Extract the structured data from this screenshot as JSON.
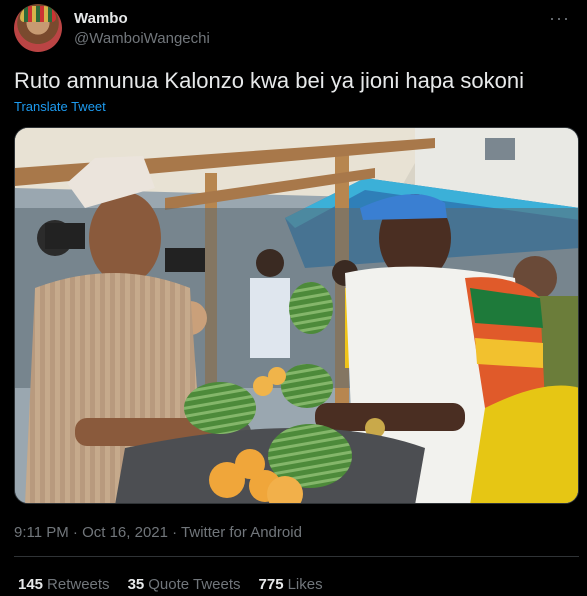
{
  "tweet": {
    "display_name": "Wambo",
    "handle": "@WamboiWangechi",
    "more_icon": "more-dots-icon",
    "text": "Ruto amnunua Kalonzo kwa bei ya jioni hapa sokoni",
    "translate_label": "Translate Tweet",
    "timestamp": "9:11 PM · Oct 16, 2021 · Twitter for Android"
  },
  "stats": {
    "retweets_count": "145",
    "retweets_label": "Retweets",
    "quote_count": "35",
    "quote_label": "Quote Tweets",
    "likes_count": "775",
    "likes_label": "Likes"
  },
  "colors": {
    "background": "#000000",
    "link": "#1d9bf0",
    "secondary_text": "#71767b"
  }
}
